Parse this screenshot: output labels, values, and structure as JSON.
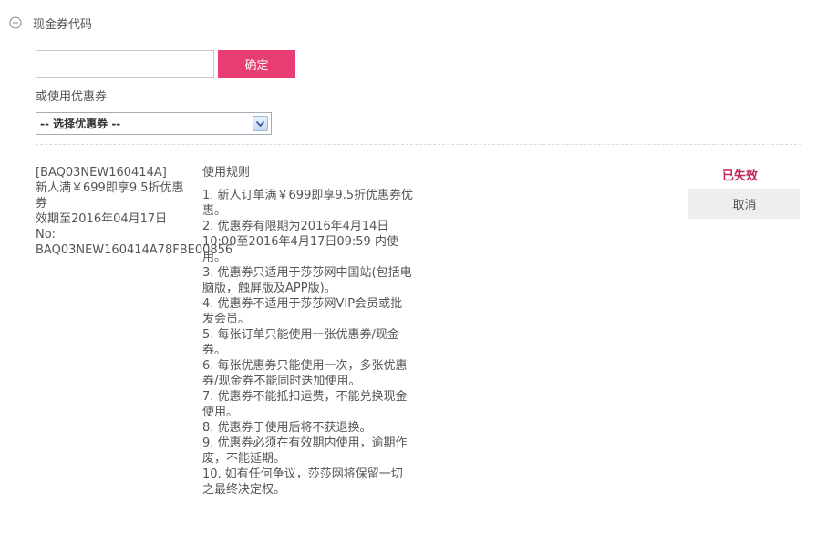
{
  "header": {
    "title": "现金券代码"
  },
  "code_input": {
    "value": "",
    "placeholder": ""
  },
  "confirm_button": {
    "label": "确定"
  },
  "or_use_label": "或使用优惠券",
  "coupon_select": {
    "selected": "-- 选择优惠券 --"
  },
  "coupon": {
    "code": "[BAQ03NEW160414A]",
    "description": "新人满￥699即享9.5折优惠券",
    "expiry": "效期至2016年04月17日",
    "no_label": "No:",
    "no_value": "BAQ03NEW160414A78FBE00856",
    "status": "已失效",
    "cancel_label": "取消"
  },
  "rules": {
    "title": "使用规则",
    "items": [
      "1. 新人订单满￥699即享9.5折优惠券优惠。",
      "2. 优惠券有限期为2016年4月14日10:00至2016年4月17日09:59 内使用。",
      "3. 优惠券只适用于莎莎网中国站(包括电脑版，触屏版及APP版)。",
      "4. 优惠券不适用于莎莎网VIP会员或批发会员。",
      "5. 每张订单只能使用一张优惠券/现金券。",
      "6. 每张优惠券只能使用一次，多张优惠券/现金券不能同时迭加使用。",
      "7. 优惠券不能抵扣运费，不能兑换现金使用。",
      "8. 优惠券于使用后将不获退换。",
      "9. 优惠券必须在有效期内使用，逾期作废，不能延期。",
      "10. 如有任何争议，莎莎网将保留一切之最终决定权。"
    ]
  }
}
